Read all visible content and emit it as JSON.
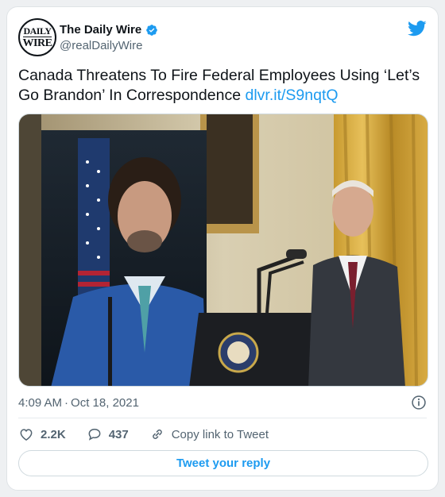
{
  "author": {
    "avatar_text_top": "DAILY",
    "avatar_text_bottom": "WIRE",
    "display_name": "The Daily Wire",
    "handle": "@realDailyWire",
    "verified_icon": "verified-badge-icon"
  },
  "brand_icon": "twitter-bird-icon",
  "tweet": {
    "text": "Canada Threatens To Fire Federal Employees Using ‘Let’s Go Brandon’ In Correspondence",
    "link": "dlvr.it/S9nqtQ"
  },
  "media": {
    "image": "photo-press-conference"
  },
  "meta": {
    "time": "4:09 AM",
    "separator": "·",
    "date": "Oct 18, 2021"
  },
  "actions": {
    "likes": "2.2K",
    "replies": "437",
    "copy_label": "Copy link to Tweet"
  },
  "reply_button": "Tweet your reply",
  "colors": {
    "accent": "#1d9bf0",
    "text": "#0f1419",
    "muted": "#536471"
  }
}
